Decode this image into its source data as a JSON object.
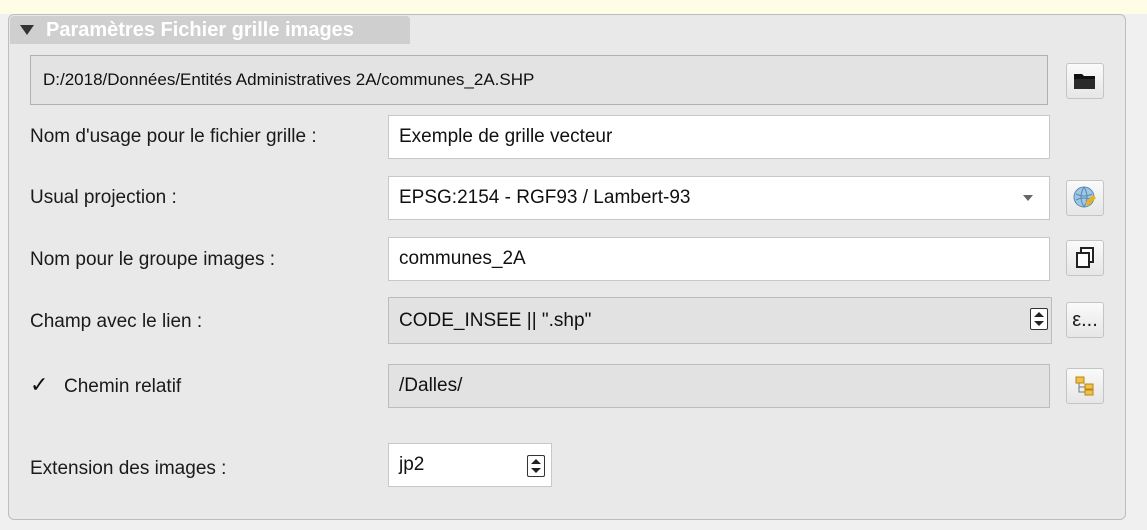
{
  "panel": {
    "title": "Paramètres Fichier grille images",
    "file_path": "D:/2018/Données/Entités Administratives 2A/communes_2A.SHP"
  },
  "fields": {
    "usage_name_label": "Nom d'usage pour le fichier grille :",
    "usage_name_value": "Exemple de grille vecteur",
    "projection_label": "Usual projection :",
    "projection_value": "EPSG:2154 - RGF93 / Lambert-93",
    "group_label": "Nom pour le groupe images :",
    "group_value": "communes_2A",
    "link_field_label": "Champ avec le lien :",
    "link_field_value": "CODE_INSEE  || \".shp\"",
    "relative_path_label": "Chemin relatif",
    "relative_path_value": "/Dalles/",
    "relative_path_checked_mark": "✓",
    "extension_label": "Extension des images :",
    "extension_value": "jp2"
  },
  "icons": {
    "browse": "folder-icon",
    "projection": "globe-projection-icon",
    "copy": "copy-icon",
    "expression": "expression-icon",
    "expression_text": "ε...",
    "directory": "directory-tree-icon"
  }
}
